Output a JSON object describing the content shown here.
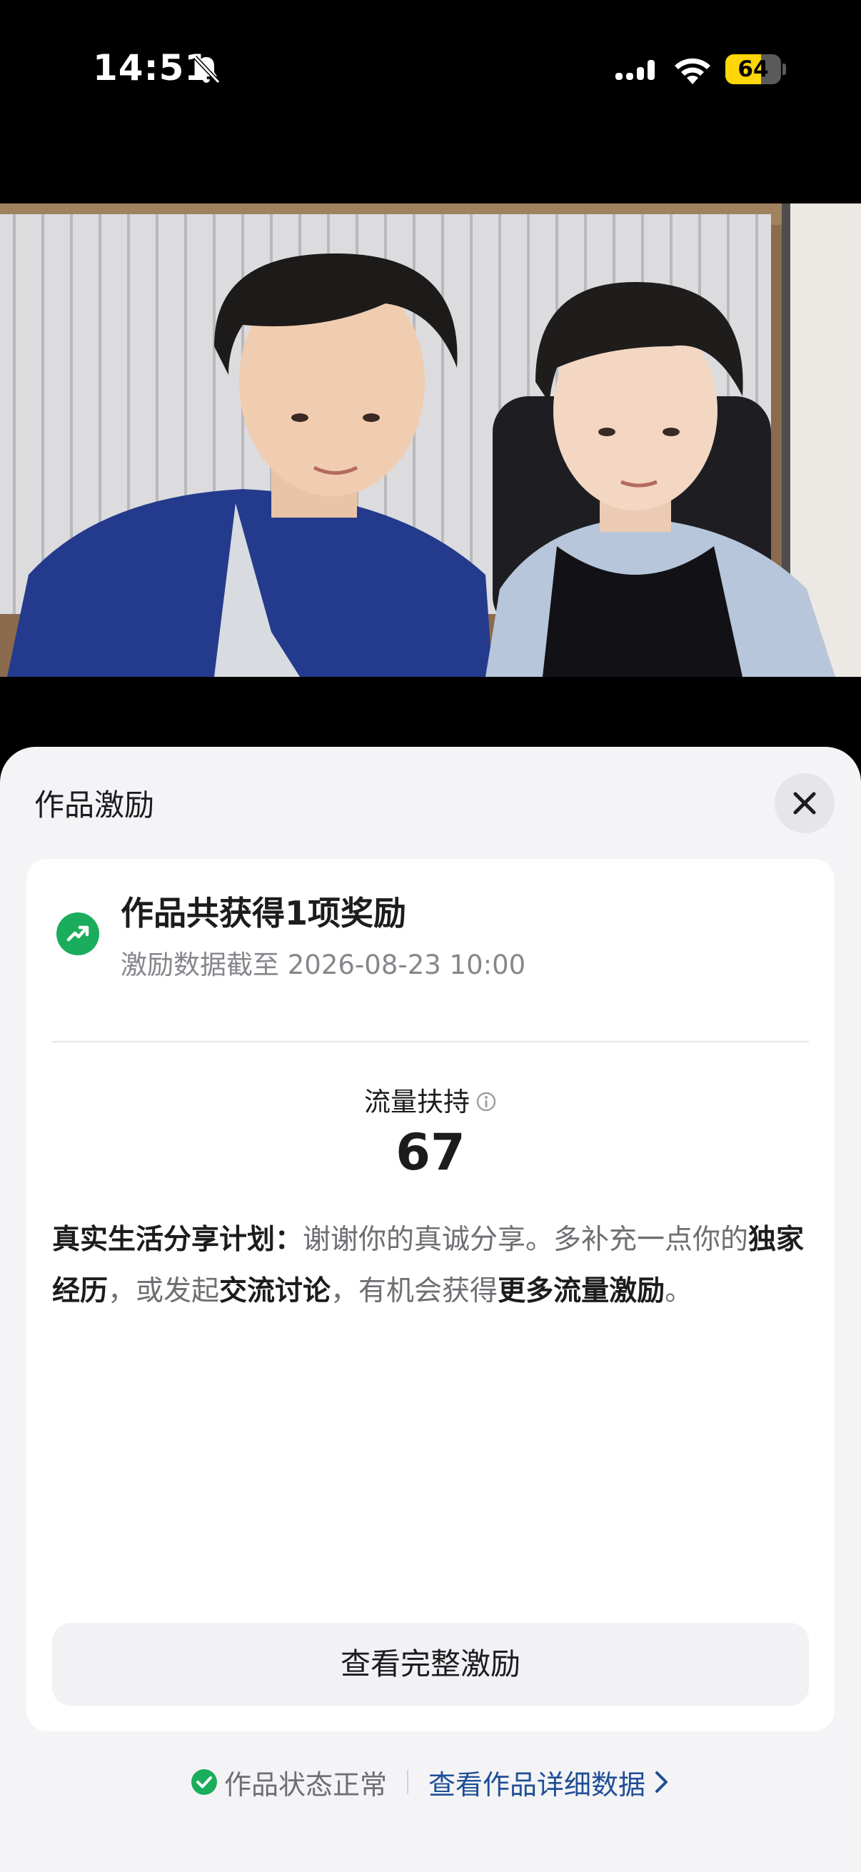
{
  "status_bar": {
    "time": "14:51",
    "battery_percent": "64",
    "battery_level": 0.64,
    "icons": [
      "bell-slash-icon",
      "signal-icon",
      "wifi-icon",
      "battery-icon"
    ]
  },
  "video": {
    "description_icon": "video-frame"
  },
  "sheet": {
    "title": "作品激励",
    "close_icon": "close-icon"
  },
  "award": {
    "title": "作品共获得1项奖励",
    "subtitle": "激励数据截至 2026-08-23 10:00",
    "icon": "trending-up-icon",
    "accent": "#1aad5b"
  },
  "metric": {
    "label": "流量扶持",
    "value": "67",
    "icon": "info-icon"
  },
  "plan": {
    "label": "真实生活分享计划：",
    "text1": "谢谢你的真诚分享。多补充一点你的",
    "highlight1": "独家经历",
    "text2": "，或发起",
    "highlight2": "交流讨论",
    "text3": "，有机会获得",
    "highlight3": "更多流量激励",
    "text4": "。"
  },
  "button": {
    "label": "查看完整激励"
  },
  "footer": {
    "status": "作品状态正常",
    "link": "查看作品详细数据",
    "link_color": "#1f4e96"
  }
}
